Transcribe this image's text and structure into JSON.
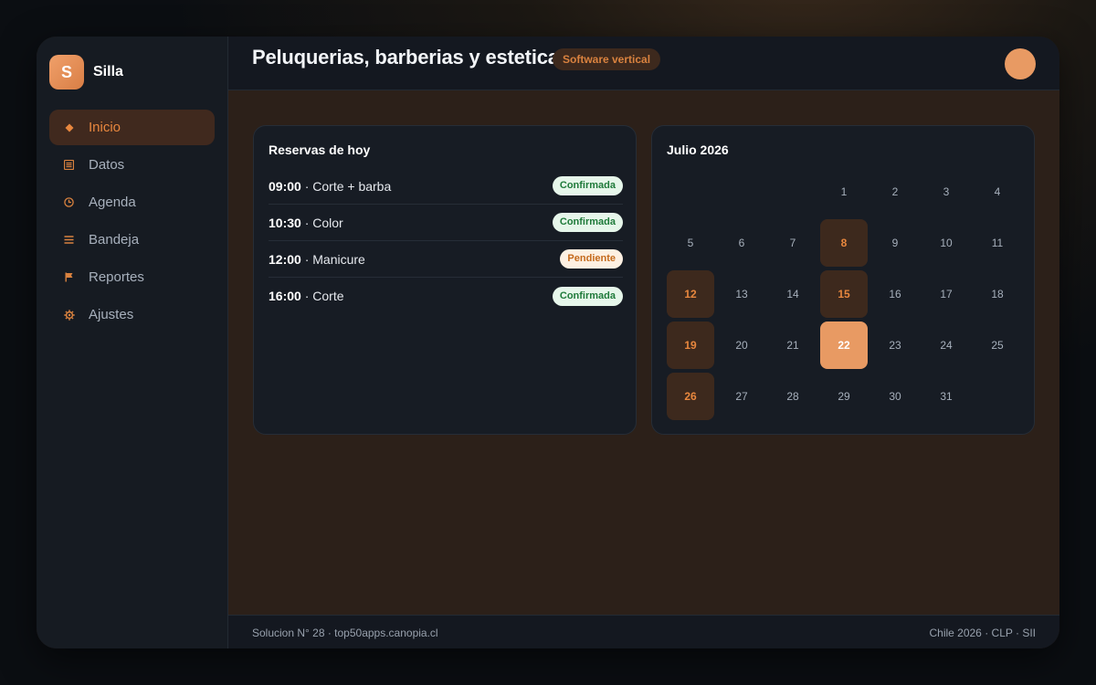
{
  "brand": {
    "logo_letter": "S",
    "name": "Silla"
  },
  "sidebar": {
    "items": [
      {
        "label": "Inicio",
        "icon": "diamond-icon",
        "active": true
      },
      {
        "label": "Datos",
        "icon": "list-icon",
        "active": false
      },
      {
        "label": "Agenda",
        "icon": "clock-icon",
        "active": false
      },
      {
        "label": "Bandeja",
        "icon": "menu-icon",
        "active": false
      },
      {
        "label": "Reportes",
        "icon": "flag-icon",
        "active": false
      },
      {
        "label": "Ajustes",
        "icon": "gear-icon",
        "active": false
      }
    ]
  },
  "header": {
    "title": "Peluquerias, barberias y estetica",
    "badge": "Software vertical"
  },
  "bookings": {
    "title": "Reservas de hoy",
    "items": [
      {
        "time": "09:00",
        "service": " · Corte + barba",
        "status": "Confirmada",
        "status_type": "ok"
      },
      {
        "time": "10:30",
        "service": " · Color",
        "status": "Confirmada",
        "status_type": "ok"
      },
      {
        "time": "12:00",
        "service": " · Manicure",
        "status": "Pendiente",
        "status_type": "pending"
      },
      {
        "time": "16:00",
        "service": " · Corte",
        "status": "Confirmada",
        "status_type": "ok"
      }
    ]
  },
  "calendar": {
    "title": "Julio 2026",
    "leading_blanks": 3,
    "days_in_month": 31,
    "busy_days": [
      8,
      12,
      15,
      19,
      26
    ],
    "today": 22
  },
  "footer": {
    "left": "Solucion N° 28 · top50apps.canopia.cl",
    "right": "Chile 2026 · CLP · SII"
  },
  "colors": {
    "accent": "#e8873e",
    "accent_soft": "#e89a63",
    "busy_bg": "#3d291d",
    "status_ok_bg": "#e6f6ea",
    "status_ok_text": "#1f7a3a",
    "status_pending_bg": "#fdf0e2",
    "status_pending_text": "#c46a1c"
  }
}
